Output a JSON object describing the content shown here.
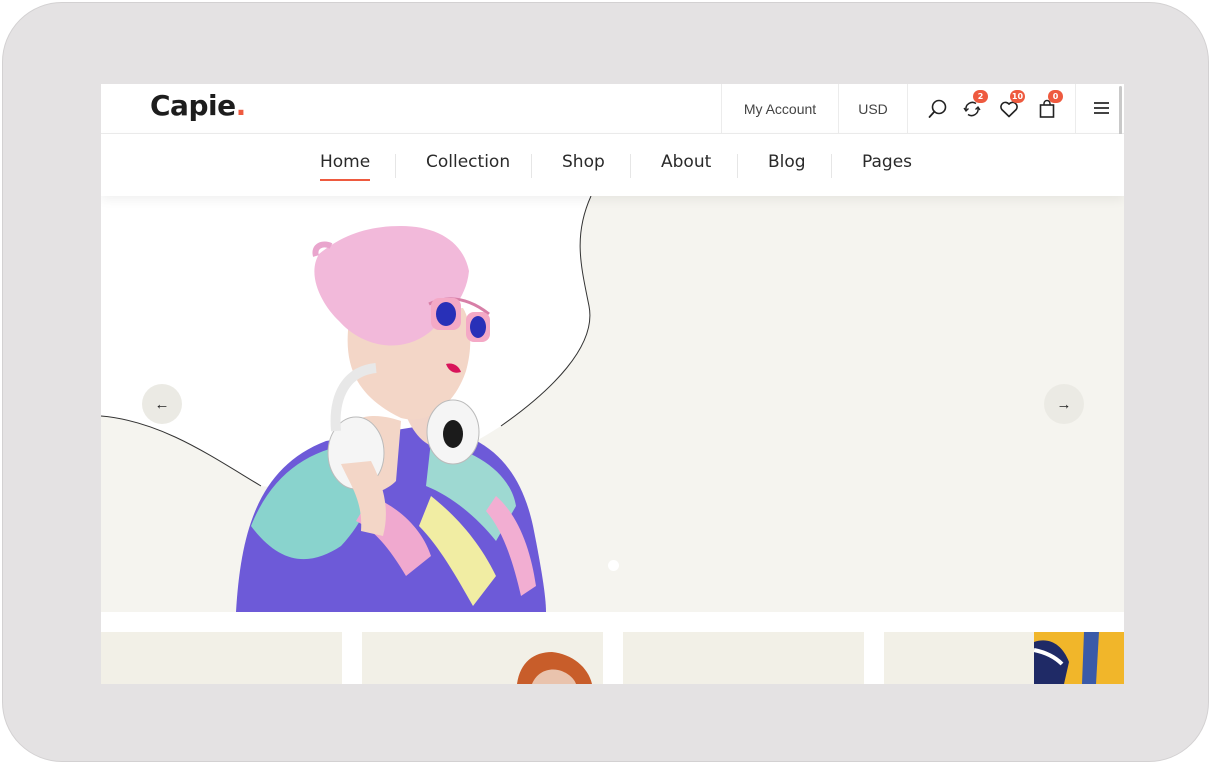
{
  "brand": {
    "logo": "Capie",
    "logo_dot": "."
  },
  "header": {
    "account_label": "My Account",
    "currency_label": "USD",
    "compare_count": "2",
    "wishlist_count": "10",
    "cart_count": "0"
  },
  "nav": {
    "items": [
      {
        "label": "Home",
        "active": true
      },
      {
        "label": "Collection"
      },
      {
        "label": "Shop"
      },
      {
        "label": "About"
      },
      {
        "label": "Blog"
      },
      {
        "label": "Pages"
      }
    ]
  },
  "hero": {
    "prev_arrow": "←",
    "next_arrow": "→",
    "slide_count": 1,
    "active_slide": 1
  },
  "icons": {
    "search": "search-icon",
    "compare": "compare-icon",
    "wishlist": "heart-icon",
    "cart": "bag-icon",
    "menu": "hamburger-icon"
  },
  "colors": {
    "accent": "#ee5a3f",
    "hero_bg": "#f5f4ef",
    "card_bg": "#f2f0e7",
    "text": "#2a2a2a"
  }
}
